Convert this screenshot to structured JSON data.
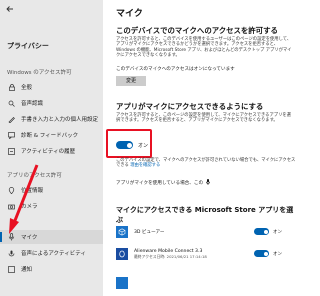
{
  "sidebar": {
    "back_icon": "back-arrow-icon",
    "title": "プライバシー",
    "group1": "Windows のアクセス許可",
    "items1": [
      {
        "label": "全般",
        "icon": "lock-icon"
      },
      {
        "label": "音声認識",
        "icon": "speech-icon"
      },
      {
        "label": "手書き入力と入力の個人用設定",
        "icon": "pen-icon"
      },
      {
        "label": "診断 & フィードバック",
        "icon": "feedback-icon"
      },
      {
        "label": "アクティビティの履歴",
        "icon": "history-icon"
      }
    ],
    "group2": "アプリのアクセス許可",
    "items2": [
      {
        "label": "位置情報",
        "icon": "location-icon"
      },
      {
        "label": "カメラ",
        "icon": "camera-icon"
      },
      {
        "label": "マイク",
        "icon": "microphone-icon",
        "active": true
      },
      {
        "label": "音声によるアクティビティ",
        "icon": "voice-icon"
      },
      {
        "label": "通知",
        "icon": "notification-icon"
      }
    ]
  },
  "main": {
    "title": "マイク",
    "section1": {
      "heading": "このデバイスでのマイクへのアクセスを許可する",
      "desc": "アクセスを許可すると、このデバイスを使用するユーザーはこのページの設定を使用して、アプリがマイクにアクセスできるかどうかを選択できます。アクセスを拒否すると、Windows の機能、Microsoft Store アプリ、およびほとんどのデスクトップ アプリがマイクにアクセスできなくなります。",
      "status": "このデバイスのマイクへのアクセスはオンになっています",
      "button": "変更"
    },
    "section2": {
      "heading": "アプリがマイクにアクセスできるようにする",
      "desc": "アクセスを許可すると、このページの設定を使用して、マイクにアクセスできるアプリを選択できます。アクセスを拒否すると、アプリがマイクにアクセスできなくなります。",
      "toggle_state": "オン",
      "note_text": "このデバイスの設定で、マイクへのアクセスが許可されていない場合でも、マイクにアクセスできる",
      "note_link": "理由を確認する",
      "when_using": "アプリがマイクを使用している場合、この",
      "icon_after": "microphone-icon"
    },
    "section3": {
      "heading": "マイクにアクセスできる Microsoft Store アプリを選ぶ",
      "apps": [
        {
          "name": "3D ビューアー",
          "sub": "",
          "state": "オン",
          "icon": "cube-icon",
          "color": "#1a73c8"
        },
        {
          "name": "Alienware Mobile Connect 3.3",
          "sub": "最終アクセス日時: 2021/06/21 17:14:18",
          "state": "オン",
          "icon": "alienware-icon",
          "color": "#1a4da1"
        },
        {
          "name": "",
          "sub": "",
          "state": "",
          "icon": "app-icon",
          "color": "#1a73c8"
        }
      ]
    }
  },
  "accent": "#0063b1",
  "highlight": "#e81123"
}
